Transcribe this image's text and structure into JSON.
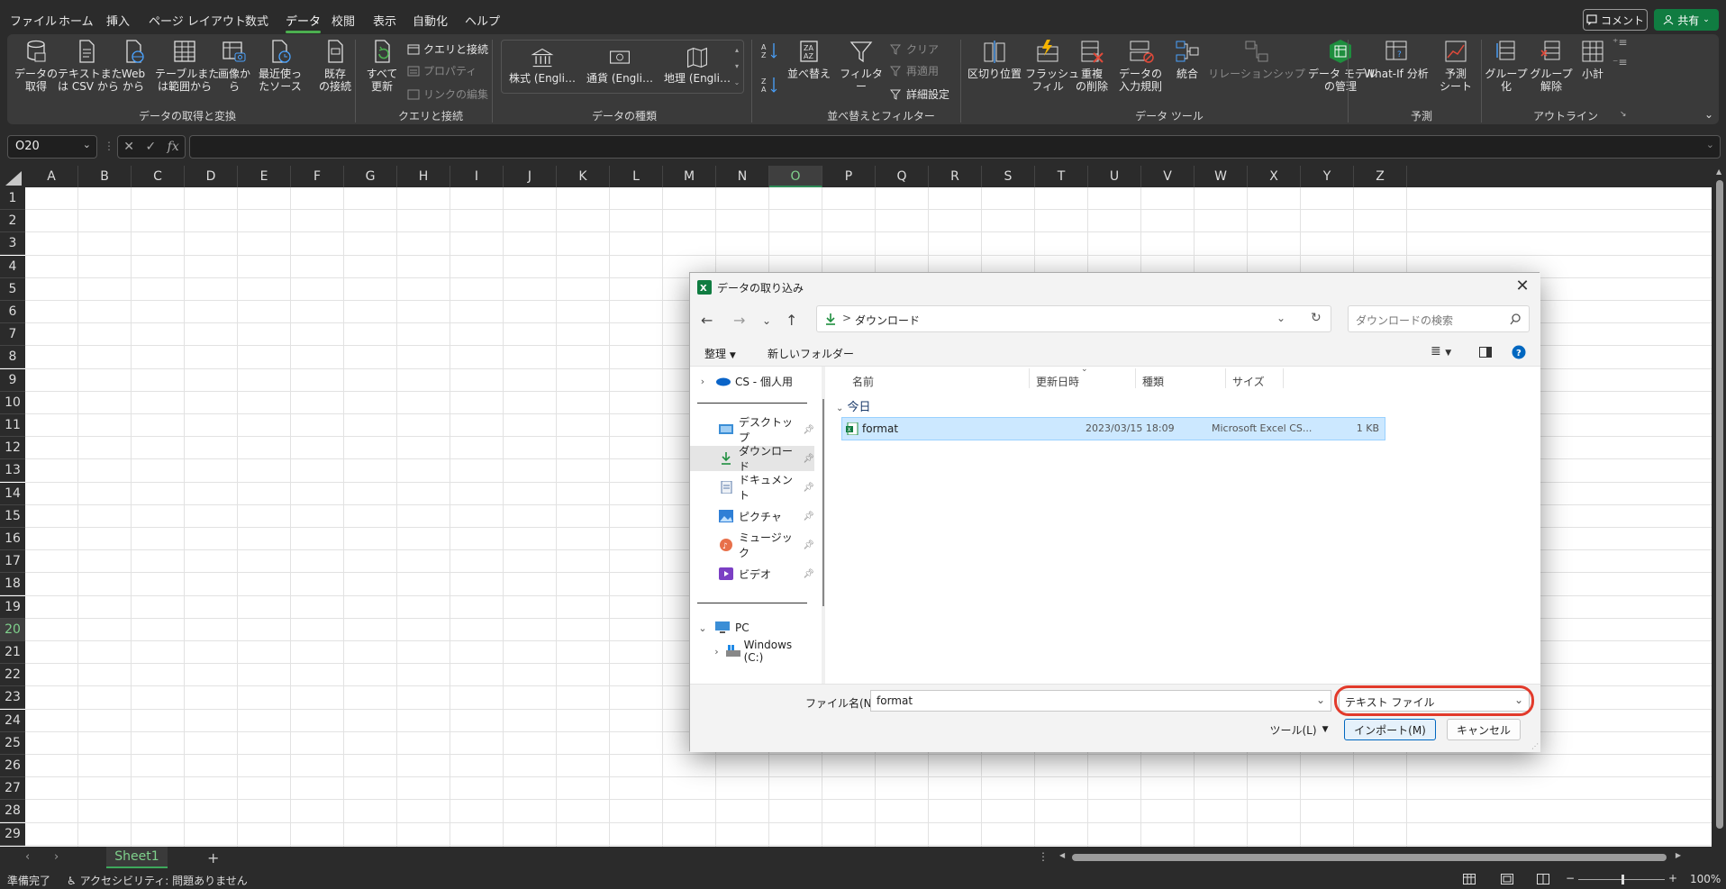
{
  "app": {
    "tabs": [
      "ファイル",
      "ホーム",
      "挿入",
      "ページ レイアウト",
      "数式",
      "データ",
      "校閲",
      "表示",
      "自動化",
      "ヘルプ"
    ],
    "active_tab": "データ",
    "comment_label": "コメント",
    "share_label": "共有"
  },
  "ribbon": {
    "get_data": "データの\n取得",
    "text_csv": "テキストまた\nは CSV から",
    "web": "Web\nから",
    "table_range": "テーブルまた\nは範囲から",
    "from_image": "画像か\nら",
    "recent_sources": "最近使っ\nたソース",
    "existing_connections": "既存\nの接続",
    "group_get_transform": "データの取得と変換",
    "refresh_all": "すべて\n更新",
    "queries_connections": "クエリと接続",
    "properties": "プロパティ",
    "edit_links": "リンクの編集",
    "group_queries": "クエリと接続",
    "stocks": "株式 (Engli…",
    "currencies": "通貨 (Engli…",
    "geography": "地理 (Engli…",
    "group_data_types": "データの種類",
    "sort": "並べ替え",
    "filter": "フィルター",
    "clear": "クリア",
    "reapply": "再適用",
    "advanced": "詳細設定",
    "group_sort_filter": "並べ替えとフィルター",
    "text_to_columns": "区切り位置",
    "flash_fill": "フラッシュ\nフィル",
    "remove_duplicates": "重複\nの削除",
    "data_validation": "データの\n入力規則",
    "consolidate": "統合",
    "relationships": "リレーションシップ",
    "data_model": "データ モデル\nの管理",
    "group_data_tools": "データ ツール",
    "what_if": "What-If 分析",
    "forecast_sheet": "予測\nシート",
    "group_forecast": "予測",
    "group": "グループ\n化",
    "ungroup": "グループ\n解除",
    "subtotal": "小計",
    "group_outline": "アウトライン"
  },
  "formula_bar": {
    "name_box": "O20",
    "fx": "fx"
  },
  "grid": {
    "columns": [
      "A",
      "B",
      "C",
      "D",
      "E",
      "F",
      "G",
      "H",
      "I",
      "J",
      "K",
      "L",
      "M",
      "N",
      "O",
      "P",
      "Q",
      "R",
      "S",
      "T",
      "U",
      "V",
      "W",
      "X",
      "Y",
      "Z"
    ],
    "selected_column": "O",
    "rows": [
      "1",
      "2",
      "3",
      "4",
      "5",
      "6",
      "7",
      "8",
      "9",
      "10",
      "11",
      "12",
      "13",
      "14",
      "15",
      "16",
      "17",
      "18",
      "19",
      "20",
      "21",
      "22",
      "23",
      "24",
      "25",
      "26",
      "27",
      "28",
      "29"
    ],
    "selected_row": "20"
  },
  "sheets": {
    "tabs": [
      "Sheet1"
    ],
    "add": "+"
  },
  "status": {
    "ready": "準備完了",
    "accessibility": "アクセシビリティ: 問題ありません",
    "zoom": "100%"
  },
  "dialog": {
    "title": "データの取り込み",
    "breadcrumb_sep": ">",
    "location": "ダウンロード",
    "search_placeholder": "ダウンロードの検索",
    "organize": "整理",
    "new_folder": "新しいフォルダー",
    "nav": [
      {
        "label": "CS - 個人用"
      },
      {
        "label": "デスクトップ"
      },
      {
        "label": "ダウンロード"
      },
      {
        "label": "ドキュメント"
      },
      {
        "label": "ピクチャ"
      },
      {
        "label": "ミュージック"
      },
      {
        "label": "ビデオ"
      },
      {
        "label": "PC"
      },
      {
        "label": "Windows (C:)"
      }
    ],
    "columns": {
      "name": "名前",
      "date": "更新日時",
      "type": "種類",
      "size": "サイズ"
    },
    "group_today": "今日",
    "file": {
      "name": "format",
      "date": "2023/03/15 18:09",
      "type": "Microsoft Excel CS...",
      "size": "1 KB"
    },
    "filename_label": "ファイル名(N):",
    "filename_value": "format",
    "filetype_value": "テキスト ファイル",
    "tools_label": "ツール(L)",
    "import_label": "インポート(M)",
    "cancel_label": "キャンセル"
  },
  "colors": {
    "accent_green": "#107c41",
    "highlight_red": "#e23a2b",
    "selection_blue": "#cce8ff"
  }
}
